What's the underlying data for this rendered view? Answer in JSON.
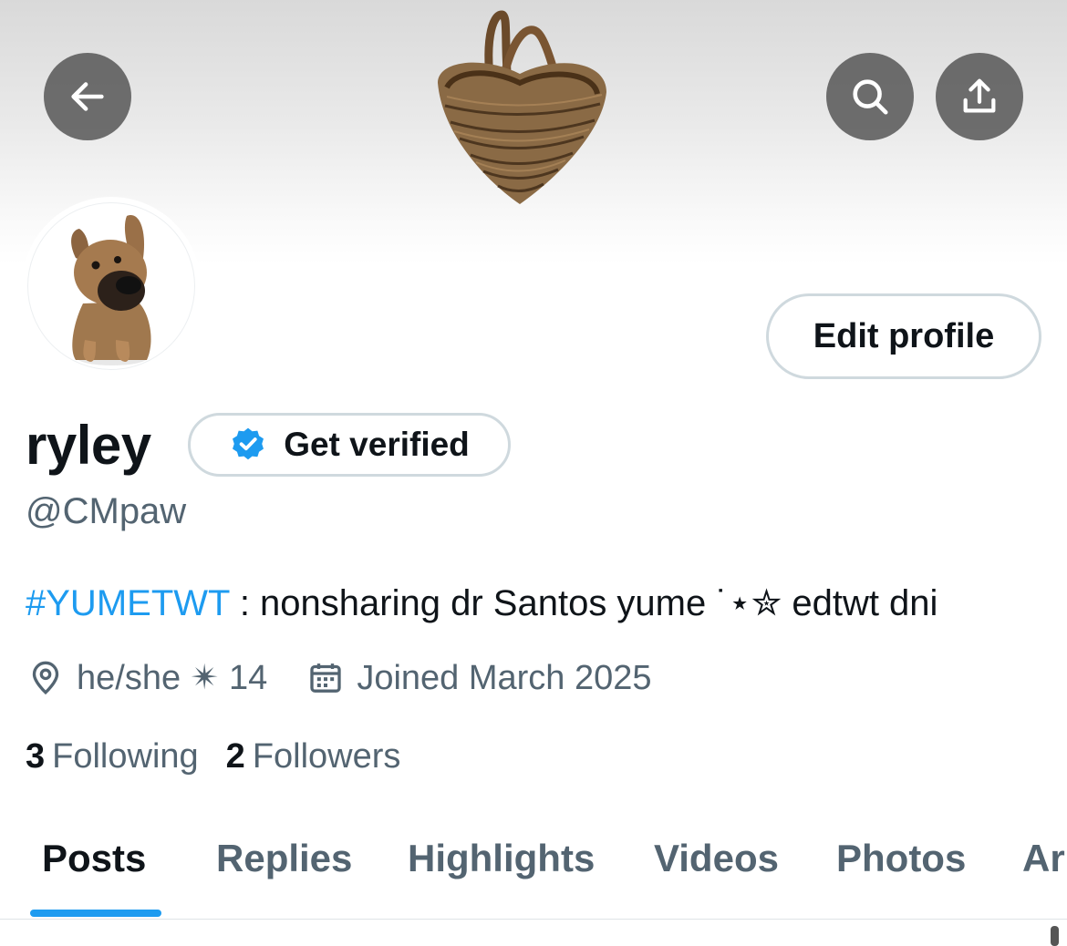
{
  "header": {
    "back_icon": "arrow-left-icon",
    "search_icon": "search-icon",
    "share_icon": "share-upload-icon",
    "banner_image": "wicker-basket"
  },
  "profile": {
    "avatar_image": "puppy",
    "edit_button": "Edit profile",
    "name": "ryley",
    "get_verified": "Get verified",
    "handle": "@CMpaw",
    "bio_hashtag": "#YUMETWT",
    "bio_text": " : nonsharing dr Santos yume ˙⋆✮ edtwt dni",
    "location": "he/she ✴ 14",
    "joined": "Joined March 2025",
    "following_count": "3",
    "following_label": "Following",
    "followers_count": "2",
    "followers_label": "Followers"
  },
  "tabs": [
    {
      "label": "Posts"
    },
    {
      "label": "Replies"
    },
    {
      "label": "Highlights"
    },
    {
      "label": "Videos"
    },
    {
      "label": "Photos"
    },
    {
      "label": "Ar"
    }
  ],
  "colors": {
    "accent": "#1d9bf0",
    "text_primary": "#0f1419",
    "text_secondary": "#536471",
    "border": "#cfd9de"
  }
}
